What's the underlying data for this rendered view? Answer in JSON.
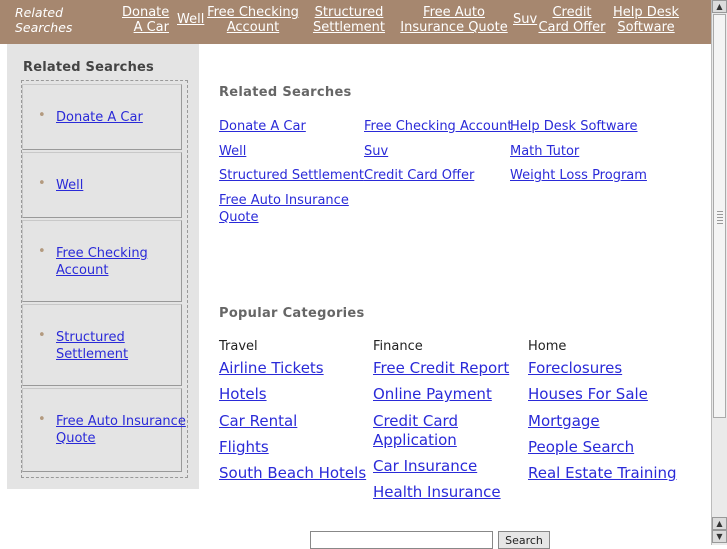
{
  "topbar": {
    "label": "Related Searches",
    "links": [
      "Donate A Car",
      "Well",
      "Free Checking Account",
      "Structured Settlement",
      "Free Auto Insurance Quote",
      "Suv",
      "Credit Card Offer",
      "Help Desk Software"
    ]
  },
  "sidebar": {
    "heading": "Related Searches",
    "items": [
      "Donate A Car",
      "Well",
      "Free Checking Account",
      "Structured Settlement",
      "Free Auto Insurance Quote"
    ]
  },
  "related": {
    "heading": "Related Searches",
    "columns": [
      [
        "Donate A Car",
        "Well",
        "Structured Settlement",
        "Free Auto Insurance Quote"
      ],
      [
        "Free Checking Account",
        "Suv",
        "Credit Card Offer"
      ],
      [
        "Help Desk Software",
        "Math Tutor",
        "Weight Loss Program"
      ]
    ]
  },
  "popular": {
    "heading": "Popular Categories",
    "categories": [
      {
        "title": "Travel",
        "links": [
          "Airline Tickets",
          "Hotels",
          "Car Rental",
          "Flights",
          "South Beach Hotels"
        ]
      },
      {
        "title": "Finance",
        "links": [
          "Free Credit Report",
          "Online Payment",
          "Credit Card Application",
          "Car Insurance",
          "Health Insurance"
        ]
      },
      {
        "title": "Home",
        "links": [
          "Foreclosures",
          "Houses For Sale",
          "Mortgage",
          "People Search",
          "Real Estate Training"
        ]
      }
    ]
  },
  "search": {
    "input_value": "",
    "button_label": "Search"
  },
  "colors": {
    "topbar_bg": "#a6876f",
    "link": "#2a2ad8",
    "sidebar_bg": "#e4e4e4"
  }
}
